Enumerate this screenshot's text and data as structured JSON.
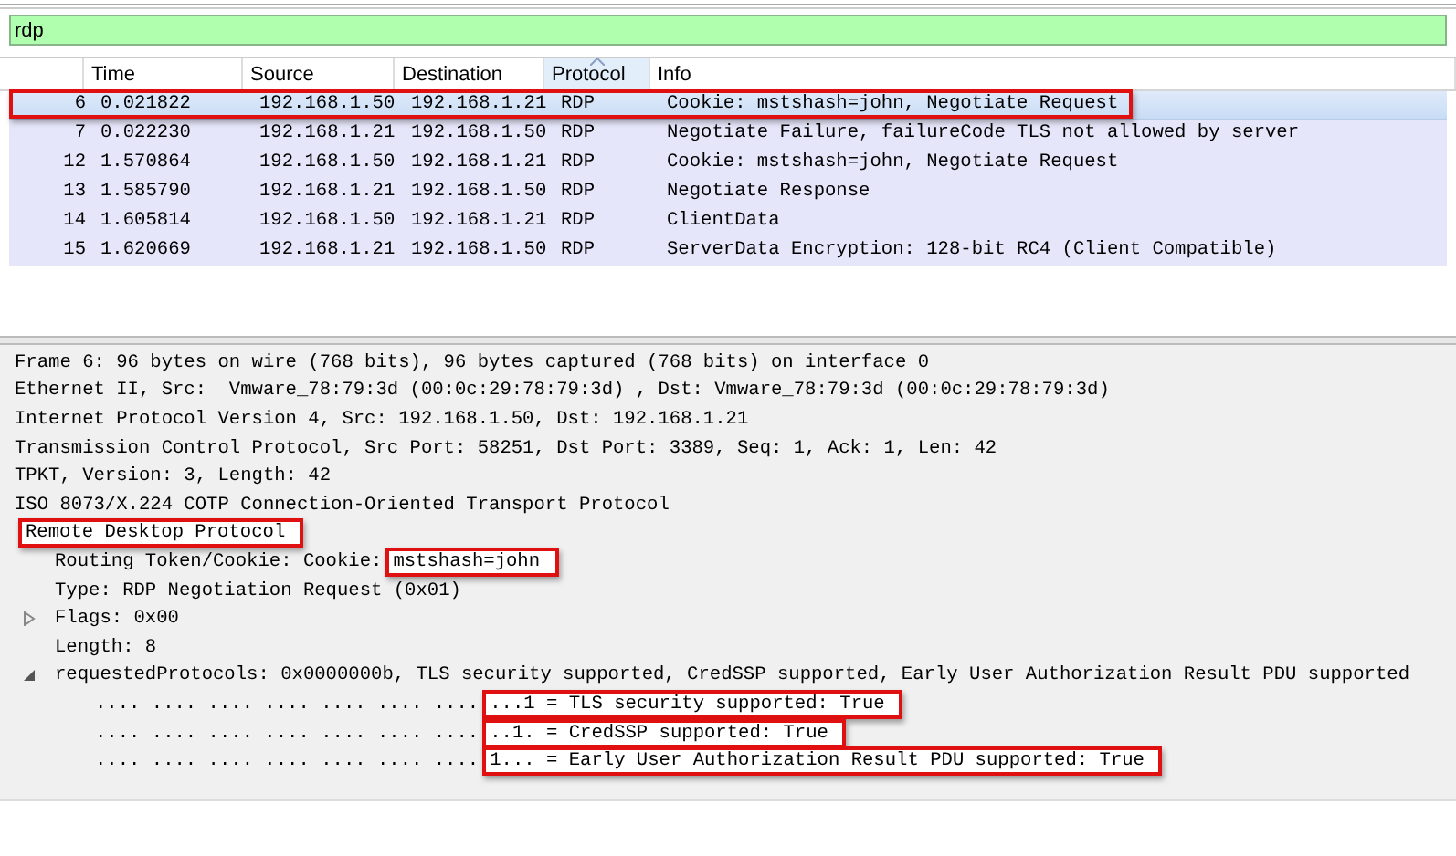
{
  "filter": {
    "value": "rdp"
  },
  "columns": [
    {
      "sorted": false
    },
    {
      "label": "Time",
      "sorted": false
    },
    {
      "label": "Source",
      "sorted": false
    },
    {
      "label": "Destination",
      "sorted": false
    },
    {
      "label": "Protocol",
      "sorted": true
    },
    {
      "label": "Info",
      "sorted": false
    }
  ],
  "packets": [
    {
      "no": "6",
      "time": "0.021822",
      "source": "192.168.1.50",
      "destination": "192.168.1.21",
      "protocol": "RDP",
      "info": "Cookie: mstshash=john, Negotiate Request",
      "selected": true,
      "highlighted": true
    },
    {
      "no": "7",
      "time": "0.022230",
      "source": "192.168.1.21",
      "destination": "192.168.1.50",
      "protocol": "RDP",
      "info": "Negotiate Failure, failureCode TLS not allowed by server",
      "selected": false,
      "highlighted": false
    },
    {
      "no": "12",
      "time": "1.570864",
      "source": "192.168.1.50",
      "destination": "192.168.1.21",
      "protocol": "RDP",
      "info": "Cookie: mstshash=john, Negotiate Request",
      "selected": false,
      "highlighted": false
    },
    {
      "no": "13",
      "time": "1.585790",
      "source": "192.168.1.21",
      "destination": "192.168.1.50",
      "protocol": "RDP",
      "info": "Negotiate Response",
      "selected": false,
      "highlighted": false
    },
    {
      "no": "14",
      "time": "1.605814",
      "source": "192.168.1.50",
      "destination": "192.168.1.21",
      "protocol": "RDP",
      "info": "ClientData",
      "selected": false,
      "highlighted": false
    },
    {
      "no": "15",
      "time": "1.620669",
      "source": "192.168.1.21",
      "destination": "192.168.1.50",
      "protocol": "RDP",
      "info": "ServerData Encryption: 128-bit RC4 (Client Compatible)",
      "selected": false,
      "highlighted": false
    }
  ],
  "details": [
    {
      "parts": [
        {
          "text": "Frame 6: 96 bytes on wire (768 bits), 96 bytes captured (768 bits) on interface 0",
          "highlighted": false
        }
      ]
    },
    {
      "parts": [
        {
          "text": "Ethernet II, Src:  Vmware_78:79:3d (00:0c:29:78:79:3d) , Dst: Vmware_78:79:3d (00:0c:29:78:79:3d)",
          "highlighted": false
        }
      ]
    },
    {
      "parts": [
        {
          "text": "Internet Protocol Version 4, Src: 192.168.1.50, Dst: 192.168.1.21",
          "highlighted": false
        }
      ]
    },
    {
      "parts": [
        {
          "text": "Transmission Control Protocol, Src Port: 58251, Dst Port: 3389, Seq: 1, Ack: 1, Len: 42",
          "highlighted": false
        }
      ]
    },
    {
      "parts": [
        {
          "text": "TPKT, Version: 3, Length: 42",
          "highlighted": false
        }
      ]
    },
    {
      "parts": [
        {
          "text": "ISO 8073/X.224 COTP Connection-Oriented Transport Protocol",
          "highlighted": false
        }
      ]
    },
    {
      "parts": [
        {
          "text": "Remote Desktop Protocol",
          "highlighted": true
        }
      ],
      "children": [
        {
          "parts": [
            {
              "text": "Routing Token/Cookie: Cookie:",
              "highlighted": false
            },
            {
              "text": "mstshash=john",
              "highlighted": true
            }
          ]
        },
        {
          "parts": [
            {
              "text": "Type: RDP Negotiation Request (0x01)",
              "highlighted": false
            }
          ]
        },
        {
          "parts": [
            {
              "text": "Flags: 0x00",
              "highlighted": false
            }
          ],
          "expanded": false
        },
        {
          "parts": [
            {
              "text": "Length: 8",
              "highlighted": false
            }
          ]
        },
        {
          "parts": [
            {
              "text": "requestedProtocols: 0x0000000b, TLS security supported, CredSSP supported, Early User Authorization Result PDU supported",
              "highlighted": false
            }
          ],
          "expanded": true,
          "children": [
            {
              "parts": [
                {
                  "text": ".... .... .... .... .... .... ....",
                  "highlighted": false
                },
                {
                  "text": "...1 = TLS security supported: True",
                  "highlighted": true
                }
              ]
            },
            {
              "parts": [
                {
                  "text": ".... .... .... .... .... .... ....",
                  "highlighted": false
                },
                {
                  "text": "..1. = CredSSP supported: True",
                  "highlighted": true
                }
              ]
            },
            {
              "parts": [
                {
                  "text": ".... .... .... .... .... .... ....",
                  "highlighted": false
                },
                {
                  "text": "1... = Early User Authorization Result PDU supported: True",
                  "highlighted": true
                }
              ]
            }
          ]
        }
      ]
    }
  ]
}
